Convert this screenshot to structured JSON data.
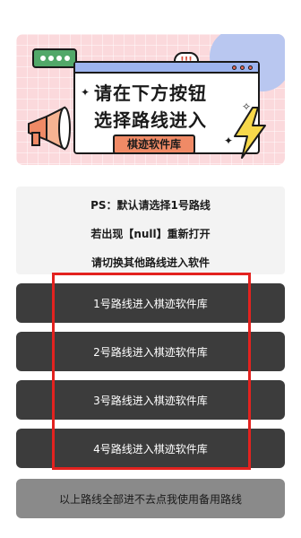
{
  "banner": {
    "line1": "请在下方按钮",
    "line2": "选择路线进入",
    "tag": "棋迹软件库",
    "alert": "!!!"
  },
  "notice": {
    "line1": "PS：默认请选择1号路线",
    "line2": "若出现【null】重新打开",
    "line3": "请切换其他路线进入软件"
  },
  "routes": [
    {
      "label": "1号路线进入棋迹软件库"
    },
    {
      "label": "2号路线进入棋迹软件库"
    },
    {
      "label": "3号路线进入棋迹软件库"
    },
    {
      "label": "4号路线进入棋迹软件库"
    }
  ],
  "backup": {
    "label": "以上路线全部进不去点我使用备用路线"
  },
  "colors": {
    "button_bg": "#3c3c3c",
    "backup_bg": "#8a8a8a",
    "highlight": "#e3221f",
    "banner_bg": "#fbd9dc"
  }
}
